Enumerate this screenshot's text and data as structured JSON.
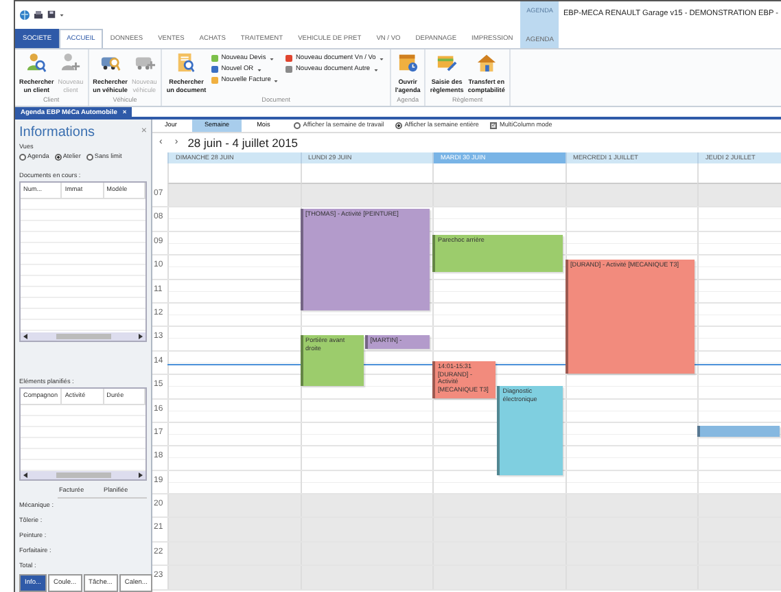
{
  "window": {
    "title": "EBP-MECA RENAULT Garage v15 - DEMONSTRATION EBP -",
    "context_group": "AGENDA"
  },
  "ribbon_tabs": [
    {
      "label": "SOCIETE",
      "kind": "file",
      "selected": false
    },
    {
      "label": "ACCUEIL",
      "kind": "tab",
      "selected": true
    },
    {
      "label": "DONNEES",
      "kind": "tab",
      "selected": false
    },
    {
      "label": "VENTES",
      "kind": "tab",
      "selected": false
    },
    {
      "label": "ACHATS",
      "kind": "tab",
      "selected": false
    },
    {
      "label": "TRAITEMENT",
      "kind": "tab",
      "selected": false
    },
    {
      "label": "VEHICULE DE PRET",
      "kind": "tab",
      "selected": false
    },
    {
      "label": "VN / VO",
      "kind": "tab",
      "selected": false
    },
    {
      "label": "DEPANNAGE",
      "kind": "tab",
      "selected": false
    },
    {
      "label": "IMPRESSION",
      "kind": "tab",
      "selected": false
    },
    {
      "label": "AGENDA",
      "kind": "context",
      "selected": false
    }
  ],
  "ribbon_groups": [
    {
      "label": "Client",
      "buttons": [
        {
          "label": "Rechercher\nun client",
          "disabled": false
        },
        {
          "label": "Nouveau\nclient",
          "disabled": true
        }
      ]
    },
    {
      "label": "Véhicule",
      "buttons": [
        {
          "label": "Rechercher\nun véhicule",
          "disabled": false
        },
        {
          "label": "Nouveau\nvéhicule",
          "disabled": true
        }
      ]
    },
    {
      "label": "Document",
      "buttons": [
        {
          "label": "Rechercher\nun document",
          "disabled": false
        }
      ],
      "small_buttons": [
        [
          {
            "label": "Nouveau Devis",
            "color": "#7cc04a",
            "dropdown": true
          },
          {
            "label": "Nouvel OR",
            "color": "#3a6fc4",
            "dropdown": true
          },
          {
            "label": "Nouvelle Facture",
            "color": "#f0b040",
            "dropdown": true
          }
        ],
        [
          {
            "label": "Nouveau document Vn / Vo",
            "color": "#e0452f",
            "dropdown": true
          },
          {
            "label": "Nouveau document Autre",
            "color": "#8a8a8a",
            "dropdown": true
          }
        ]
      ]
    },
    {
      "label": "Agenda",
      "buttons": [
        {
          "label": "Ouvrir\nl'agenda",
          "disabled": false
        }
      ]
    },
    {
      "label": "Règlement",
      "buttons": [
        {
          "label": "Saisie des\nrèglements",
          "disabled": false
        },
        {
          "label": "Transfert en\ncomptabilité",
          "disabled": false
        }
      ]
    }
  ],
  "document_tab": {
    "label": "Agenda EBP MéCa Automobile",
    "close": "×"
  },
  "info_panel": {
    "title": "Informations",
    "close": "×",
    "views_label": "Vues",
    "views": [
      {
        "label": "Agenda",
        "selected": false
      },
      {
        "label": "Atelier",
        "selected": true
      },
      {
        "label": "Sans limit",
        "selected": false
      }
    ],
    "documents": {
      "label": "Documents en cours :",
      "columns": [
        "Num...",
        "Immat",
        "Modèle"
      ]
    },
    "planned": {
      "label": "Eléments planifiés :",
      "columns": [
        "Compagnon",
        "Activité",
        "Durée"
      ]
    },
    "summary": {
      "columns": [
        "Facturée",
        "Planifiée"
      ],
      "rows": [
        "Mécanique :",
        "Tôlerie :",
        "Peinture :",
        "Forfaitaire :",
        "Total :"
      ]
    },
    "tabs": [
      {
        "label": "Info...",
        "selected": true
      },
      {
        "label": "Coule...",
        "selected": false
      },
      {
        "label": "Tâche...",
        "selected": false
      },
      {
        "label": "Calen...",
        "selected": false
      }
    ]
  },
  "calendar": {
    "views": [
      {
        "label": "Jour",
        "selected": false
      },
      {
        "label": "Semaine",
        "selected": true
      },
      {
        "label": "Mois",
        "selected": false
      }
    ],
    "options": [
      {
        "label": "Afficher la semaine de travail",
        "kind": "radio",
        "checked": false
      },
      {
        "label": "Afficher la semaine entière",
        "kind": "radio",
        "checked": true
      },
      {
        "label": "MultiColumn mode",
        "kind": "checkbox",
        "checked": true
      }
    ],
    "prev": "‹",
    "next": "›",
    "range": "28 juin - 4 juillet 2015",
    "days": [
      {
        "label": "DIMANCHE 28 JUIN",
        "today": false
      },
      {
        "label": "LUNDI 29 JUIN",
        "today": false,
        "events": [
          {
            "color": "#b39bcb",
            "text": "[THOMAS] - Activité [PEINTURE]"
          },
          {
            "color": "#9ccc6c",
            "text": "Portière avant droite"
          },
          {
            "color": "#b39bcb",
            "text": "[MARTIN] -"
          }
        ]
      },
      {
        "label": "MARDI 30 JUIN",
        "today": true,
        "events": [
          {
            "color": "#9ccc6c",
            "text": "Parechoc arrière"
          },
          {
            "color": "#f28b7d",
            "text": "14:01-15:31 [DURAND] - Activité [MECANIQUE T3]"
          },
          {
            "color": "#7fcfe0",
            "text": "Diagnostic électronique"
          }
        ]
      },
      {
        "label": "MERCREDI 1 JUILLET",
        "today": false,
        "events": [
          {
            "color": "#f28b7d",
            "text": "[DURAND] - Activité [MECANIQUE T3]"
          }
        ]
      },
      {
        "label": "JEUDI 2 JUILLET",
        "today": false,
        "events": [
          {
            "color": "#86b8e0"
          }
        ]
      }
    ],
    "hours": [
      {
        "label": "07",
        "shaded": true
      },
      {
        "label": "08",
        "shaded": false
      },
      {
        "label": "09",
        "shaded": false
      },
      {
        "label": "10",
        "shaded": false
      },
      {
        "label": "11",
        "shaded": false
      },
      {
        "label": "12",
        "shaded": false
      },
      {
        "label": "13",
        "shaded": false
      },
      {
        "label": "14",
        "shaded": false
      },
      {
        "label": "15",
        "shaded": false
      },
      {
        "label": "16",
        "shaded": false
      },
      {
        "label": "17",
        "shaded": false
      },
      {
        "label": "18",
        "shaded": false
      },
      {
        "label": "19",
        "shaded": false
      },
      {
        "label": "20",
        "shaded": true
      },
      {
        "label": "21",
        "shaded": true
      },
      {
        "label": "22",
        "shaded": true
      },
      {
        "label": "23",
        "shaded": true
      }
    ]
  }
}
